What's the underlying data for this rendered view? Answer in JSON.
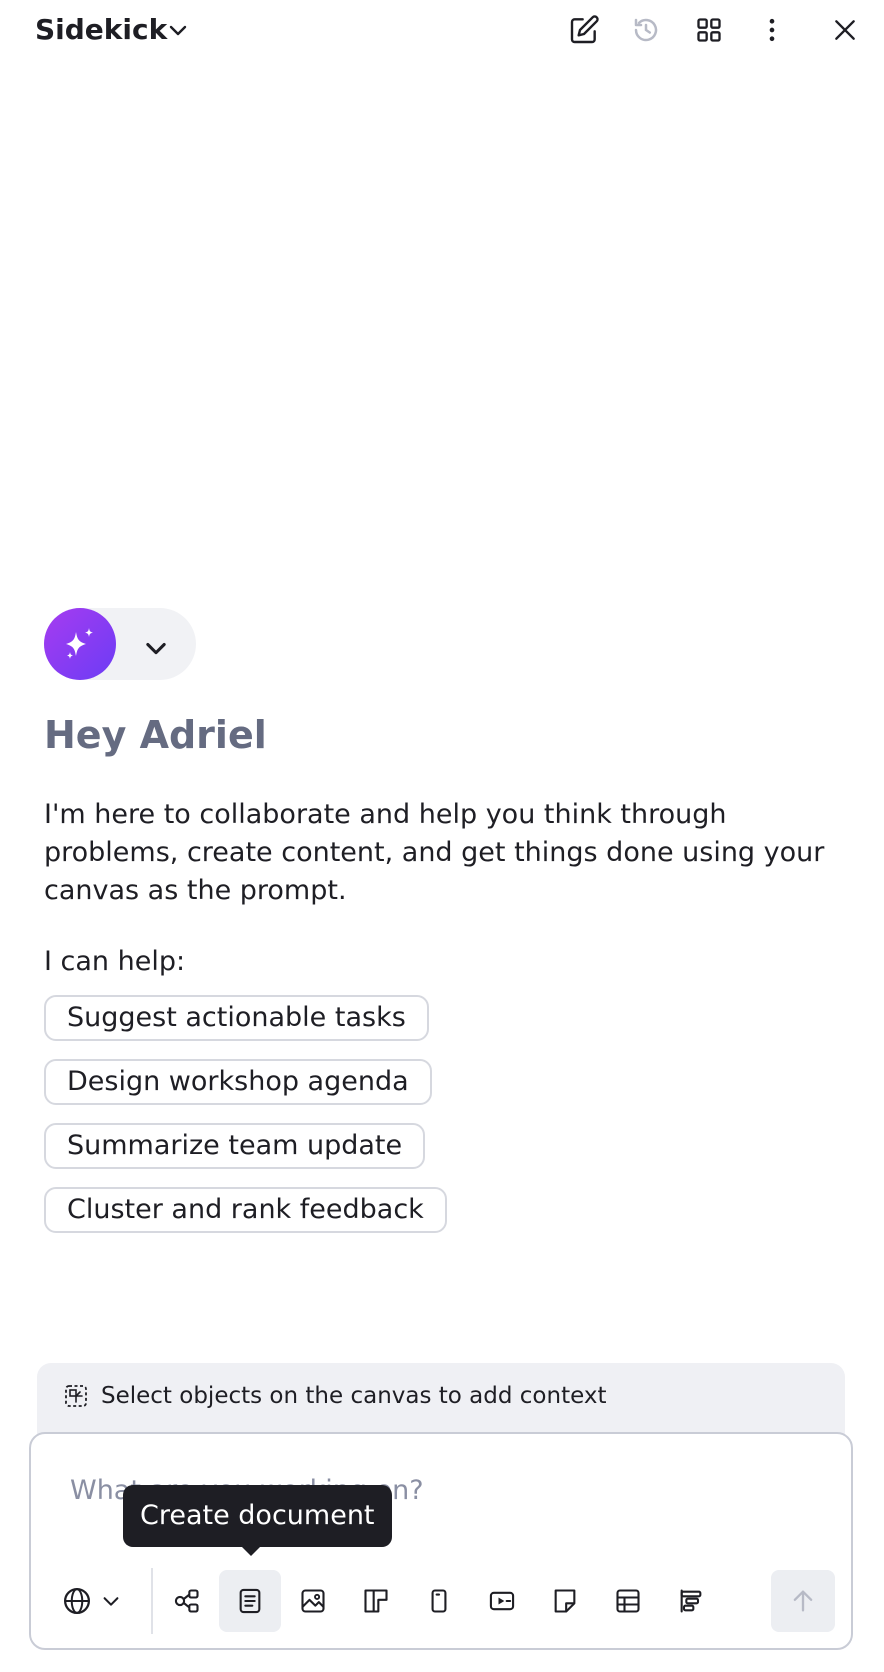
{
  "header": {
    "title": "Sidekick",
    "buttons": [
      "new-chat",
      "history",
      "apps",
      "more",
      "close"
    ]
  },
  "agent": {
    "avatar_icon": "sparkle-icon",
    "gradient": [
      "#a63cf0",
      "#6c3cf5"
    ]
  },
  "welcome": {
    "greeting": "Hey Adriel",
    "intro": "I'm here to collaborate and help you think through problems, create content, and get things done using your canvas as the prompt.",
    "can_help": "I can help:",
    "suggestions": [
      "Suggest actionable tasks",
      "Design workshop agenda",
      "Summarize team update",
      "Cluster and rank feedback"
    ]
  },
  "context": {
    "text": "Select objects on the canvas to add context"
  },
  "prompt": {
    "placeholder": "What are you working on?",
    "tooltip": "Create document",
    "tools": [
      "diagram",
      "document",
      "image",
      "kanban",
      "sticky-card",
      "slide",
      "sticky-note",
      "table",
      "timeline"
    ],
    "active_tool": "document"
  },
  "colors": {
    "greeting": "#656b81",
    "text": "#1e1e24",
    "panel": "#eff0f4"
  }
}
